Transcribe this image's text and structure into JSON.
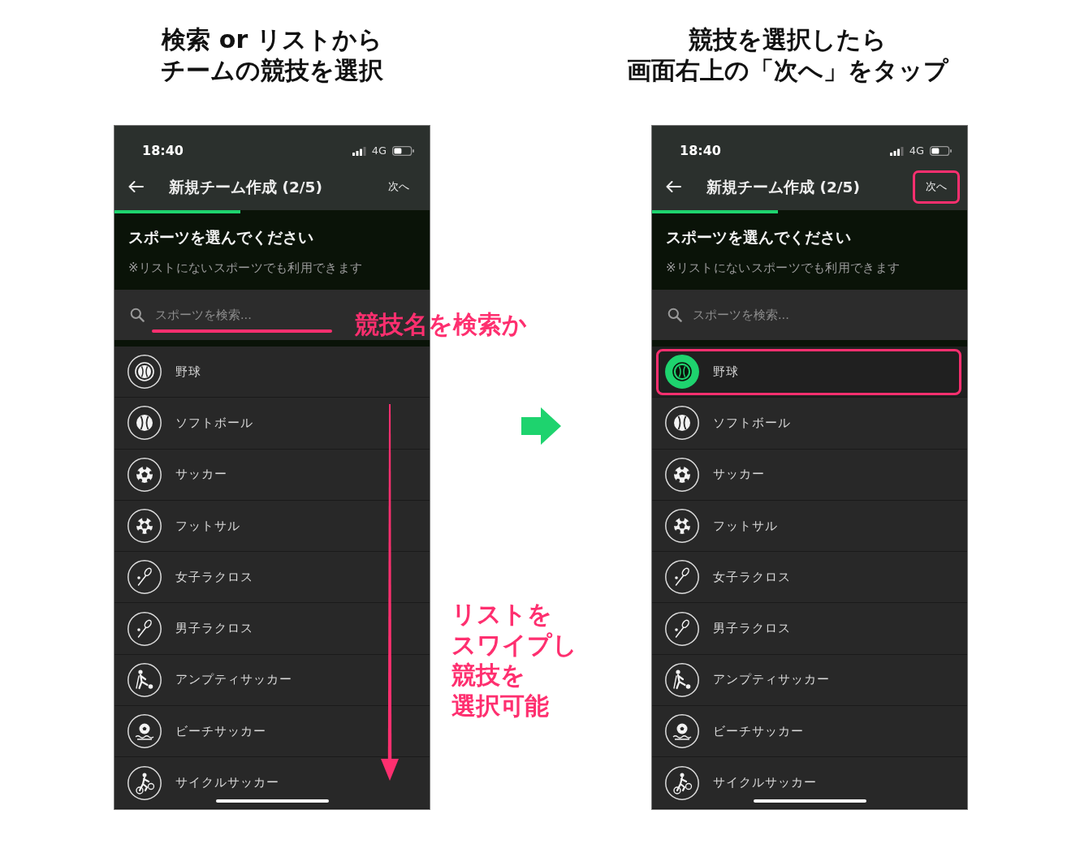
{
  "panels": [
    {
      "heading": [
        "検索 or リストから",
        "チームの競技を選択"
      ],
      "phone": {
        "status_bar": {
          "time": "18:40",
          "network": "4G"
        },
        "nav": {
          "title": "新規チーム作成 (2/5)",
          "next_button": {
            "label": "次へ",
            "highlighted": false
          }
        },
        "progress": {
          "level": 0.4
        },
        "prompt": {
          "title": "スポーツを選んでください",
          "note": "※リストにないスポーツでも利用できます"
        },
        "search": {
          "placeholder": "スポーツを検索...",
          "highlighted": true
        },
        "sports": [
          {
            "name": "野球",
            "kind": "baseball",
            "selected": false,
            "highlighted": false
          },
          {
            "name": "ソフトボール",
            "kind": "softball",
            "selected": false,
            "highlighted": false
          },
          {
            "name": "サッカー",
            "kind": "soccer",
            "selected": false,
            "highlighted": false
          },
          {
            "name": "フットサル",
            "kind": "futsal",
            "selected": false,
            "highlighted": false
          },
          {
            "name": "女子ラクロス",
            "kind": "lacrosse",
            "selected": false,
            "highlighted": false
          },
          {
            "name": "男子ラクロス",
            "kind": "lacrosse",
            "selected": false,
            "highlighted": false
          },
          {
            "name": "アンプティサッカー",
            "kind": "amputee",
            "selected": false,
            "highlighted": false
          },
          {
            "name": "ビーチサッカー",
            "kind": "beach",
            "selected": false,
            "highlighted": false
          },
          {
            "name": "サイクルサッカー",
            "kind": "cycle",
            "selected": false,
            "highlighted": false
          }
        ]
      },
      "callouts": [
        {
          "kind": "search",
          "lines": [
            "競技名を検索か"
          ]
        },
        {
          "kind": "swipe",
          "lines": [
            "リストを",
            "スワイプし",
            "競技を",
            "選択可能"
          ]
        }
      ]
    },
    {
      "heading": [
        "競技を選択したら",
        "画面右上の「次へ」をタップ"
      ],
      "phone": {
        "status_bar": {
          "time": "18:40",
          "network": "4G"
        },
        "nav": {
          "title": "新規チーム作成 (2/5)",
          "next_button": {
            "label": "次へ",
            "highlighted": true
          }
        },
        "progress": {
          "level": 0.4
        },
        "prompt": {
          "title": "スポーツを選んでください",
          "note": "※リストにないスポーツでも利用できます"
        },
        "search": {
          "placeholder": "スポーツを検索...",
          "highlighted": false
        },
        "sports": [
          {
            "name": "野球",
            "kind": "baseball",
            "selected": true,
            "highlighted": true
          },
          {
            "name": "ソフトボール",
            "kind": "softball",
            "selected": false,
            "highlighted": false
          },
          {
            "name": "サッカー",
            "kind": "soccer",
            "selected": false,
            "highlighted": false
          },
          {
            "name": "フットサル",
            "kind": "futsal",
            "selected": false,
            "highlighted": false
          },
          {
            "name": "女子ラクロス",
            "kind": "lacrosse",
            "selected": false,
            "highlighted": false
          },
          {
            "name": "男子ラクロス",
            "kind": "lacrosse",
            "selected": false,
            "highlighted": false
          },
          {
            "name": "アンプティサッカー",
            "kind": "amputee",
            "selected": false,
            "highlighted": false
          },
          {
            "name": "ビーチサッカー",
            "kind": "beach",
            "selected": false,
            "highlighted": false
          },
          {
            "name": "サイクルサッカー",
            "kind": "cycle",
            "selected": false,
            "highlighted": false
          }
        ]
      }
    }
  ]
}
